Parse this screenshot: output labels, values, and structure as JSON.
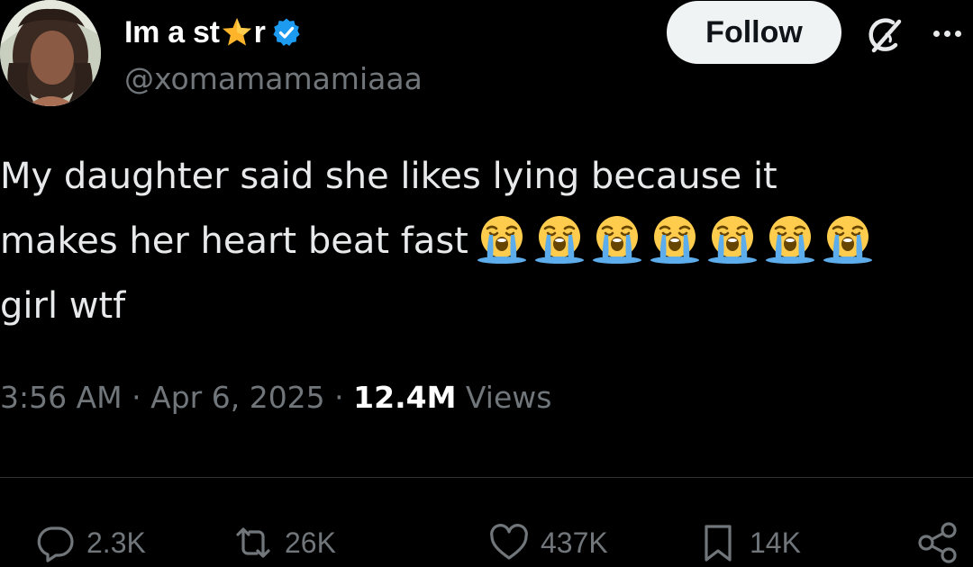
{
  "author": {
    "name_before_star": "Im a st",
    "name_after_star": "r",
    "handle": "@xomamamamiaaa",
    "verified": true
  },
  "header": {
    "follow_label": "Follow"
  },
  "icons": {
    "star": "star-emoji",
    "verified": "verified-badge-icon",
    "grok": "grok-icon",
    "more": "more-icon",
    "reply": "reply-icon",
    "repost": "repost-icon",
    "like": "heart-icon",
    "bookmark": "bookmark-icon",
    "share": "share-icon",
    "emoji": "loudly-crying-face-emoji"
  },
  "tweet": {
    "line1": "My daughter said she likes lying because it",
    "line2": "makes her heart beat fast",
    "line3": "girl wtf",
    "emoji_count": 7
  },
  "meta": {
    "time": "3:56 AM",
    "separator": " · ",
    "date": "Apr 6, 2025",
    "views_count": "12.4M",
    "views_label": " Views"
  },
  "actions": {
    "replies": "2.3K",
    "reposts": "26K",
    "likes": "437K",
    "bookmarks": "14K"
  },
  "colors": {
    "background": "#000000",
    "text": "#e7e9ea",
    "secondary": "#71767b",
    "verified_blue": "#1d9bf0",
    "follow_bg": "#eff3f4",
    "divider": "#2f3336"
  }
}
